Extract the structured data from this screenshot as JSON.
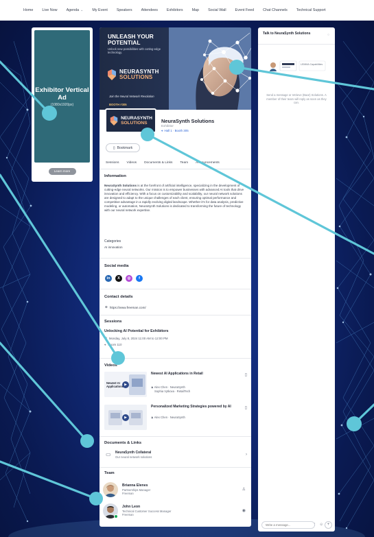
{
  "nav": {
    "items": [
      {
        "label": "Home",
        "chevron": false
      },
      {
        "label": "Live Now",
        "chevron": false
      },
      {
        "label": "Agenda",
        "chevron": true
      },
      {
        "label": "My Event",
        "chevron": false
      },
      {
        "label": "Speakers",
        "chevron": false
      },
      {
        "label": "Attendees",
        "chevron": false
      },
      {
        "label": "Exhibitors",
        "chevron": false
      },
      {
        "label": "Map",
        "chevron": false
      },
      {
        "label": "Social Wall",
        "chevron": false
      },
      {
        "label": "Event Feed",
        "chevron": false
      },
      {
        "label": "Chat Channels",
        "chevron": false
      },
      {
        "label": "Technical Support",
        "chevron": false
      }
    ]
  },
  "ad": {
    "title": "Exhibitor Vertical Ad",
    "size": "(1080x1920px)",
    "button": "Learn more",
    "bg_color": "#2f6a78"
  },
  "banner": {
    "headline": "UNLEASH YOUR POTENTIAL",
    "text": "Unlock new possibilities with cutting-edge technology.",
    "brand_line1": "NEURASYNTH",
    "brand_line2": "SOLUTIONS",
    "join": "Join the Neural Network Revolution",
    "booth": "BOOTH #305"
  },
  "exhibitor": {
    "name": "NeuraSynth Solutions",
    "type": "Exhibitor",
    "location": "Hall 1 · Booth 305",
    "bookmark": "Bookmark",
    "logo_line1": "NEURASYNTH",
    "logo_line2": "SOLUTIONS"
  },
  "tabs": [
    {
      "label": "Sessions",
      "active": false
    },
    {
      "label": "Videos",
      "active": false
    },
    {
      "label": "Documents & Links",
      "active": false
    },
    {
      "label": "Team",
      "active": false
    },
    {
      "label": "Announcements",
      "active": false
    }
  ],
  "information": {
    "title": "Information",
    "brand": "NeuraSynth Solutions",
    "body": " is at the forefront of artificial intelligence, specializing in the development of cutting-edge neural networks. Our mission is to empower businesses with advanced AI tools that drive innovation and efficiency. With a focus on customizability and scalability, our neural network solutions are designed to adapt to the unique challenges of each client, ensuring optimal performance and competitive advantage in a rapidly evolving digital landscape. Whether it's for data analysis, predictive modeling, or automation, NeuraSynth Solutions is dedicated to transforming the future of technology with our neural network expertise.",
    "categories_label": "Categories",
    "categories_value": "AI innovation"
  },
  "social": {
    "title": "Social media",
    "icons": [
      {
        "name": "linkedin-icon",
        "glyph": "in",
        "color": "#2867b2"
      },
      {
        "name": "x-icon",
        "glyph": "X",
        "color": "#111111"
      },
      {
        "name": "instagram-icon",
        "glyph": "◎",
        "color": "#b44dd6"
      },
      {
        "name": "facebook-icon",
        "glyph": "f",
        "color": "#1877f2"
      }
    ]
  },
  "contact": {
    "title": "Contact details",
    "url": "https://www.freeman.com/"
  },
  "sessions": {
    "title": "Sessions",
    "item_title": "Unlocking AI Potential for Exhibitors",
    "time": "Monday, July 8, 2024 11:00 AM to 12:00 PM",
    "room": "Room 110"
  },
  "videos": {
    "title": "Videos",
    "items": [
      {
        "title": "Newest AI Applications in Retail",
        "thumb_text": "Newest AI Applications",
        "speakers": "Alex Chen · NeuraSynth",
        "speakers2": "Sophia Vytkova · RetailTech"
      },
      {
        "title": "Personalized Marketing Strategies powered by AI",
        "thumb_text": "",
        "speakers": "Alex Chen · NeuraSynth",
        "speakers2": ""
      }
    ]
  },
  "documents": {
    "title": "Documents & Links",
    "item_title": "NeuraSynth Collateral",
    "item_sub": "Our neural network solutions"
  },
  "team": {
    "title": "Team",
    "members": [
      {
        "name": "Brianna Elenes",
        "role": "Partnerships Manager",
        "company": "Freeman",
        "action_icon": "person-icon"
      },
      {
        "name": "John Leon",
        "role": "Technical Customer Success Manager",
        "company": "Freeman",
        "action_icon": "eye-icon"
      }
    ]
  },
  "chat": {
    "title": "Talk to NeuraSynth Solutions",
    "message": "Send a message or retrieve (Baar) Solutions. A member of their team will reply as soon as they can.",
    "placeholder": "Write a message...",
    "card_label": "LEMMA Capabilities"
  },
  "colors": {
    "accent": "#2f66d6",
    "brand_orange": "#f4b07a",
    "callout": "#5fc6d8"
  }
}
